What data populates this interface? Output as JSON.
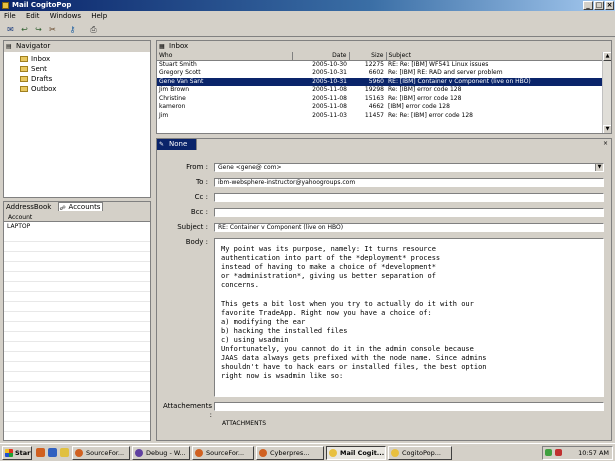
{
  "window": {
    "title": "Mail CogitoPop",
    "min": "_",
    "max": "□",
    "close": "×"
  },
  "menu": [
    "File",
    "Edit",
    "Windows",
    "Help"
  ],
  "navigator": {
    "tab": "Navigator",
    "folders": [
      "Inbox",
      "Sent",
      "Drafts",
      "Outbox"
    ]
  },
  "lower_left": {
    "tabs": [
      "AddressBook",
      "Accounts"
    ],
    "column": "Account",
    "rows": [
      "LAPTOP"
    ]
  },
  "inbox": {
    "tab": "Inbox",
    "columns": [
      "Who",
      "Date",
      "Size",
      "Subject"
    ],
    "rows": [
      [
        "Stuart Smith",
        "2005-10-30",
        "12275",
        "RE: Re: [IBM] WF541 Linux issues"
      ],
      [
        "Gregory Scott",
        "2005-10-31",
        "6602",
        "Re: [IBM] RE: RAD and server problem"
      ],
      [
        "Gene Van Sant",
        "2005-10-31",
        "5960",
        "RE: [IBM] Container v Component (live on HBO)"
      ],
      [
        "Jim Brown",
        "2005-11-08",
        "19298",
        "Re: [IBM] error code 128"
      ],
      [
        "Christine",
        "2005-11-08",
        "15163",
        "Re: [IBM] error code 128"
      ],
      [
        "kameron",
        "2005-11-08",
        "4662",
        "[IBM] error code 128"
      ],
      [
        "Jim",
        "2005-11-03",
        "11457",
        "Re: Re: [IBM] error code 128"
      ]
    ],
    "selected": 2
  },
  "compose": {
    "tab": "None",
    "labels": {
      "from": "From :",
      "to": "To :",
      "cc": "Cc :",
      "bcc": "Bcc :",
      "subject": "Subject :",
      "body": "Body :",
      "attachments": "Attachements :"
    },
    "from_value": "Gene            <gene@          com>",
    "to_value": "ibm-websphere-instructor@yahoogroups.com",
    "cc_value": "",
    "bcc_value": "",
    "subject_value": "RE:          Container v Component (live on HBO)",
    "attachments_value": "",
    "cut_label": "ATTACHMENTS",
    "body": "My point was its purpose, namely: It turns resource\nauthentication into part of the *deployment* process\ninstead of having to make a choice of *development*\nor *administration*, giving us better separation of\nconcerns.\n\nThis gets a bit lost when you try to actually do it with our\nfavorite TradeApp. Right now you have a choice of:\na) modifying the ear\nb) hacking the installed files\nc) using wsadmin\nUnfortunately, you cannot do it in the admin console because\nJAAS data always gets prefixed with the node name. Since admins\nshouldn't have to hack ears or installed files, the best option\nright now is wsadmin like so:"
  },
  "taskbar": {
    "start": "Start",
    "buttons": [
      "SourceFor...",
      "Debug - W...",
      "SourceFor...",
      "Cyberpres...",
      "Mail Cogit...",
      "CogitoPop..."
    ],
    "active": 4,
    "clock": "10:57 AM"
  },
  "colors": {
    "selection": "#0a246a",
    "chrome": "#d4d0c8",
    "title_start": "#0a246a"
  }
}
